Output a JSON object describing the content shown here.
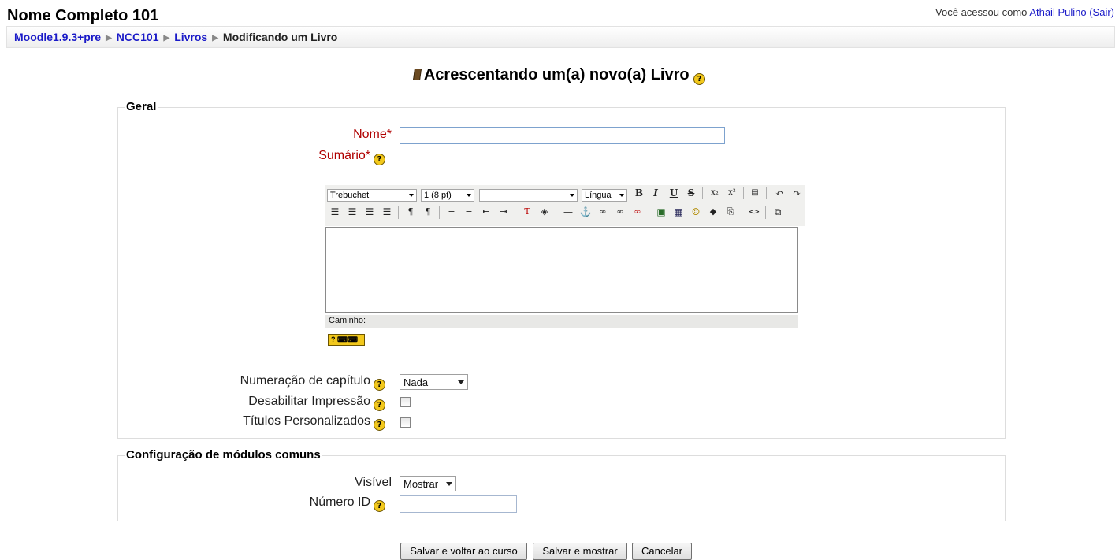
{
  "header": {
    "site_title": "Nome Completo 101",
    "login_prefix": "Você acessou como",
    "user_name": "Athail Pulino",
    "logout_label": "(Sair)"
  },
  "breadcrumb": {
    "items": [
      "Moodle1.9.3+pre",
      "NCC101",
      "Livros"
    ],
    "current": "Modificando um Livro",
    "separator": "▶"
  },
  "page": {
    "heading": "Acrescentando um(a) novo(a) Livro"
  },
  "general": {
    "legend": "Geral",
    "name_label": "Nome*",
    "name_value": "",
    "summary_label": "Sumário*",
    "editor": {
      "font_select": "Trebuchet",
      "size_select": "1 (8 pt)",
      "format_select": "",
      "lang_select": "Língua",
      "path_label": "Caminho:",
      "help_keyboard": "?"
    },
    "numbering_label": "Numeração de capítulo",
    "numbering_value": "Nada",
    "disable_print_label": "Desabilitar Impressão",
    "custom_titles_label": "Títulos Personalizados"
  },
  "common": {
    "legend": "Configuração de módulos comuns",
    "visible_label": "Visível",
    "visible_value": "Mostrar",
    "id_label": "Número ID",
    "id_value": ""
  },
  "buttons": {
    "save_return": "Salvar e voltar ao curso",
    "save_display": "Salvar e mostrar",
    "cancel": "Cancelar"
  },
  "colors": {
    "required": "#b00000",
    "link": "#1a1ac8",
    "help_icon": "#f2c81c"
  }
}
